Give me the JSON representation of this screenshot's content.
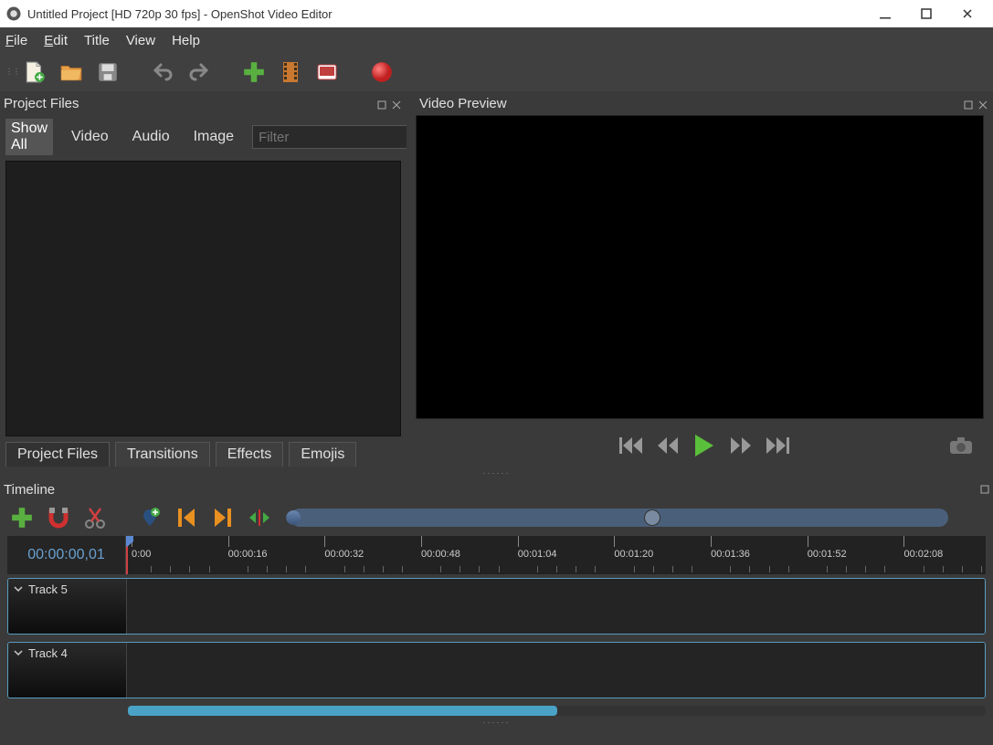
{
  "window": {
    "title": "Untitled Project [HD 720p 30 fps] - OpenShot Video Editor"
  },
  "menu": {
    "file": "File",
    "edit": "Edit",
    "title": "Title",
    "view": "View",
    "help": "Help"
  },
  "toolbar_icons": {
    "new": "new-file-icon",
    "open": "open-folder-icon",
    "save": "save-icon",
    "undo": "undo-icon",
    "redo": "redo-icon",
    "import": "plus-icon",
    "profile": "film-icon",
    "fullscreen": "screen-icon",
    "export": "record-icon"
  },
  "panels": {
    "project_files": "Project Files",
    "video_preview": "Video Preview",
    "timeline": "Timeline"
  },
  "file_tabs": {
    "show_all": "Show All",
    "video": "Video",
    "audio": "Audio",
    "image": "Image",
    "filter_placeholder": "Filter"
  },
  "bottom_tabs": {
    "project_files": "Project Files",
    "transitions": "Transitions",
    "effects": "Effects",
    "emojis": "Emojis"
  },
  "ruler": {
    "current_time": "00:00:00,01",
    "majors": [
      "0:00",
      "00:00:16",
      "00:00:32",
      "00:00:48",
      "00:01:04",
      "00:01:20",
      "00:01:36",
      "00:01:52",
      "00:02:08"
    ]
  },
  "tracks": {
    "t5": "Track 5",
    "t4": "Track 4"
  }
}
